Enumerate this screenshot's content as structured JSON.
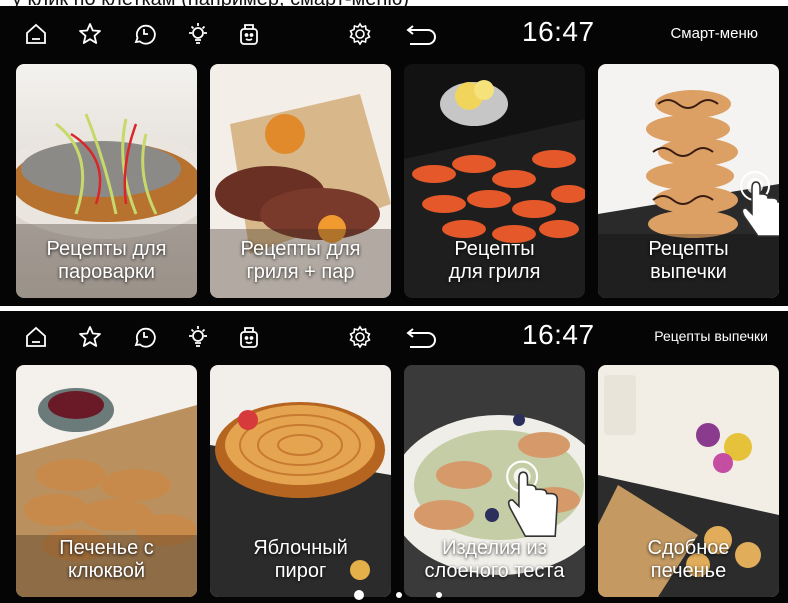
{
  "header_clip": "у клик по клеткам (например, смарт-меню)",
  "screens": [
    {
      "time": "16:47",
      "menu_title": "Смарт-меню",
      "cards": [
        {
          "label": "Рецепты для\nпароварки"
        },
        {
          "label": "Рецепты для\nгриля + пар"
        },
        {
          "label": "Рецепты\nдля гриля"
        },
        {
          "label": "Рецепты\nвыпечки"
        }
      ]
    },
    {
      "time": "16:47",
      "menu_title": "Рецепты выпечки",
      "cards": [
        {
          "label": "Печенье с\nклюквой"
        },
        {
          "label": "Яблочный\nпирог"
        },
        {
          "label": "Изделия из\nслоеного теста"
        },
        {
          "label": "Сдобное\nпеченье"
        }
      ]
    }
  ],
  "icons": [
    "home-icon",
    "favorite-star-icon",
    "clock-history-icon",
    "light-bulb-icon",
    "recipe-pot-icon",
    "settings-gear-icon",
    "back-arrow-icon"
  ],
  "pagination": {
    "pages": 3,
    "active": 1
  },
  "colors": {
    "screen_bg": "#050505",
    "text": "#ffffff"
  }
}
